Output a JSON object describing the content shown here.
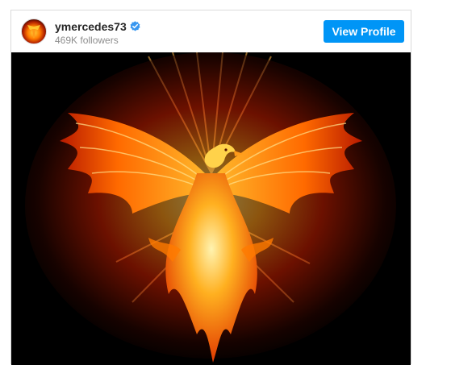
{
  "profile": {
    "username": "ymercedes73",
    "followers": "469K followers",
    "verified": true,
    "avatar_icon": "phoenix-avatar-icon",
    "verified_icon": "verified-badge-icon"
  },
  "actions": {
    "view_profile_label": "View Profile"
  },
  "media": {
    "subject": "phoenix-fire-image",
    "colors": {
      "background": "#000000",
      "flame_core": "#ffd23a",
      "flame_mid": "#ff7a00",
      "flame_outer": "#c41e00"
    }
  },
  "theme": {
    "button": "#0095f6",
    "text": "#262626",
    "muted": "#8e8e8e",
    "border": "#dbdbdb"
  }
}
